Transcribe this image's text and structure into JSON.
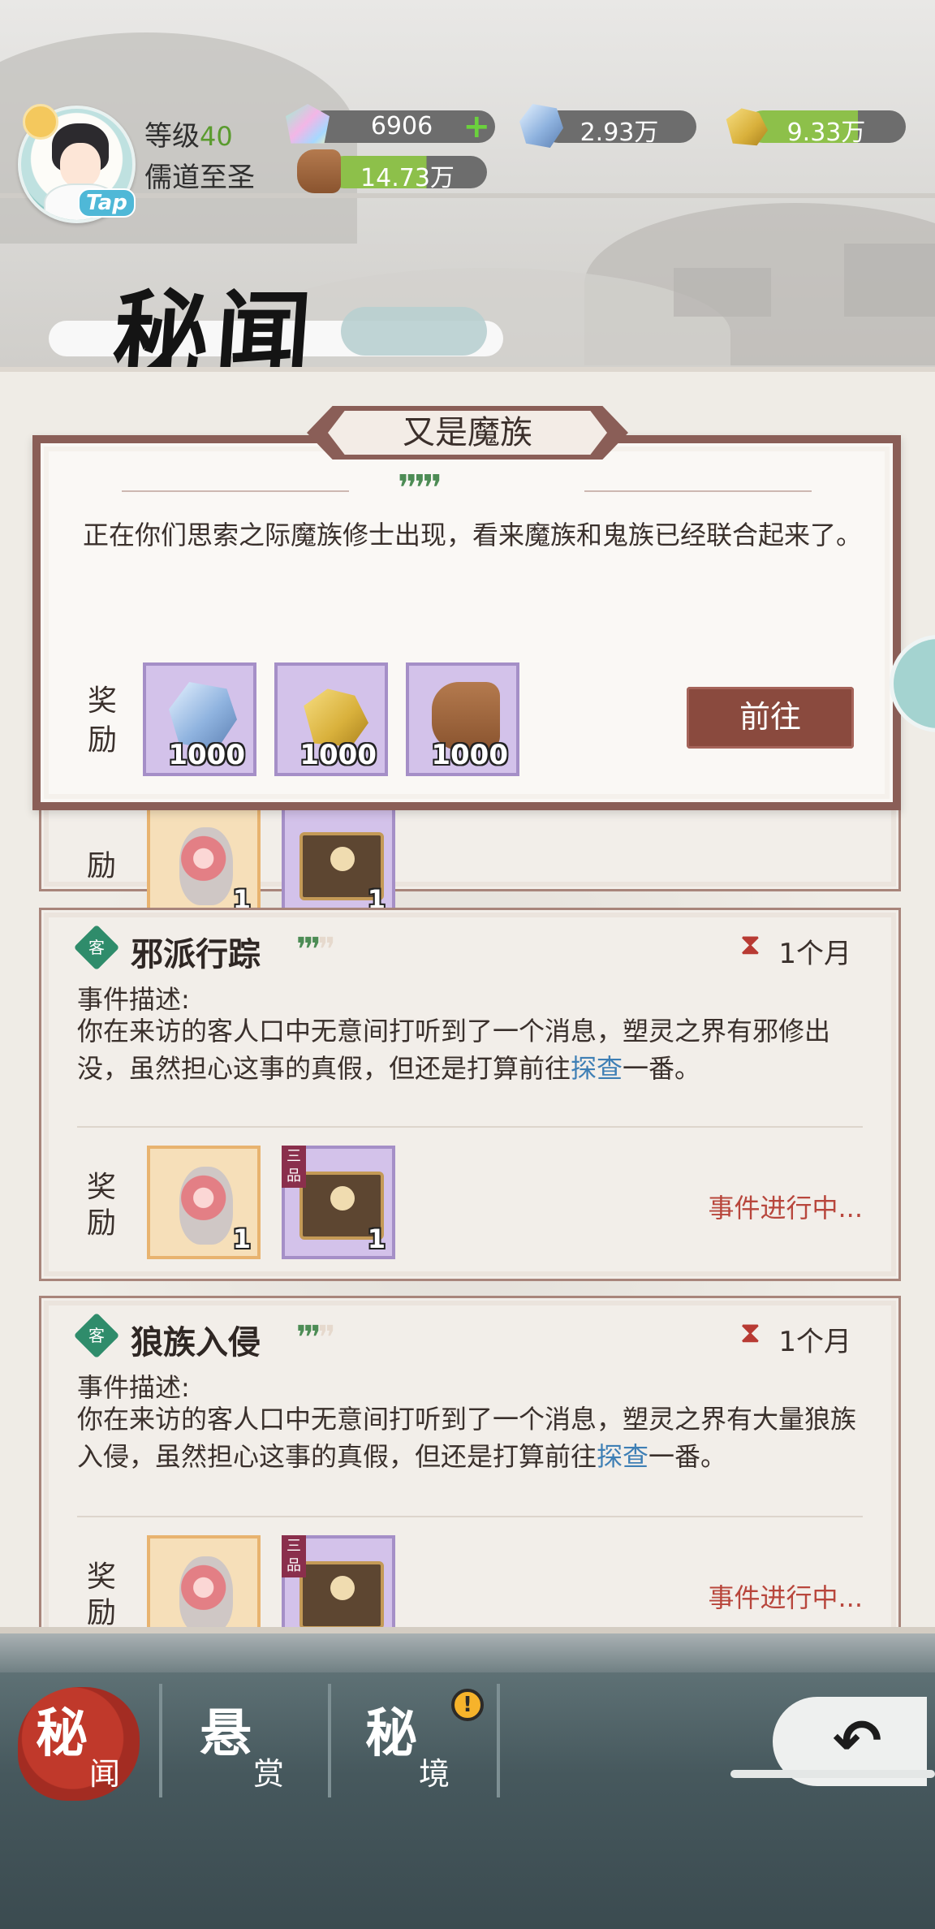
{
  "header": {
    "level_label": "等级",
    "level_value": "40",
    "player_title": "儒道至圣",
    "tap_label": "Tap",
    "resources": {
      "jade": "6906",
      "stone": "2.93万",
      "gold": "9.33万",
      "wood": "14.73万"
    }
  },
  "page_title": "秘闻",
  "popup": {
    "title": "又是魔族",
    "stars": "❜❜❜❜❜",
    "description": "正在你们思索之际魔族修士出现，看来魔族和鬼族已经联合起来了。",
    "reward_label": "奖励",
    "rewards": [
      {
        "icon": "spirit-stone-icon",
        "qty": "1000"
      },
      {
        "icon": "gold-ore-icon",
        "qty": "1000"
      },
      {
        "icon": "wood-log-icon",
        "qty": "1000"
      }
    ],
    "go_button": "前往"
  },
  "partial_card": {
    "reward_label": "励",
    "rewards": [
      {
        "qty": "1"
      },
      {
        "qty": "1"
      }
    ]
  },
  "events": [
    {
      "badge": "客",
      "name": "邪派行踪",
      "stars_on": "❜❜❜",
      "stars_off": "❜❜",
      "duration": "1个月",
      "desc_label": "事件描述:",
      "desc_before": "你在来访的客人口中无意间打听到了一个消息，塑灵之界有邪修出没，虽然担心这事的真假，但还是打算前往",
      "desc_highlight": "探查",
      "desc_after": "一番。",
      "reward_label": "奖励",
      "rewards": [
        {
          "icon": "red-stone-icon",
          "qty": "1"
        },
        {
          "icon": "treasure-chest-icon",
          "tier": "三品",
          "qty": "1"
        }
      ],
      "status": "事件进行中..."
    },
    {
      "badge": "客",
      "name": "狼族入侵",
      "stars_on": "❜❜❜",
      "stars_off": "❜❜",
      "duration": "1个月",
      "desc_label": "事件描述:",
      "desc_before": "你在来访的客人口中无意间打听到了一个消息，塑灵之界有大量狼族入侵，虽然担心这事的真假，但还是打算前往",
      "desc_highlight": "探查",
      "desc_after": "一番。",
      "reward_label": "奖励",
      "rewards": [
        {
          "icon": "red-stone-icon",
          "qty": ""
        },
        {
          "icon": "treasure-chest-icon",
          "tier": "三品",
          "qty": ""
        }
      ],
      "status": "事件进行中..."
    }
  ],
  "nav": {
    "tabs": [
      {
        "big": "秘",
        "small": "闻",
        "active": true
      },
      {
        "big": "悬",
        "small": "赏",
        "active": false
      },
      {
        "big": "秘",
        "small": "境",
        "active": false
      }
    ],
    "alert_mark": "!",
    "back_label": "↶"
  }
}
